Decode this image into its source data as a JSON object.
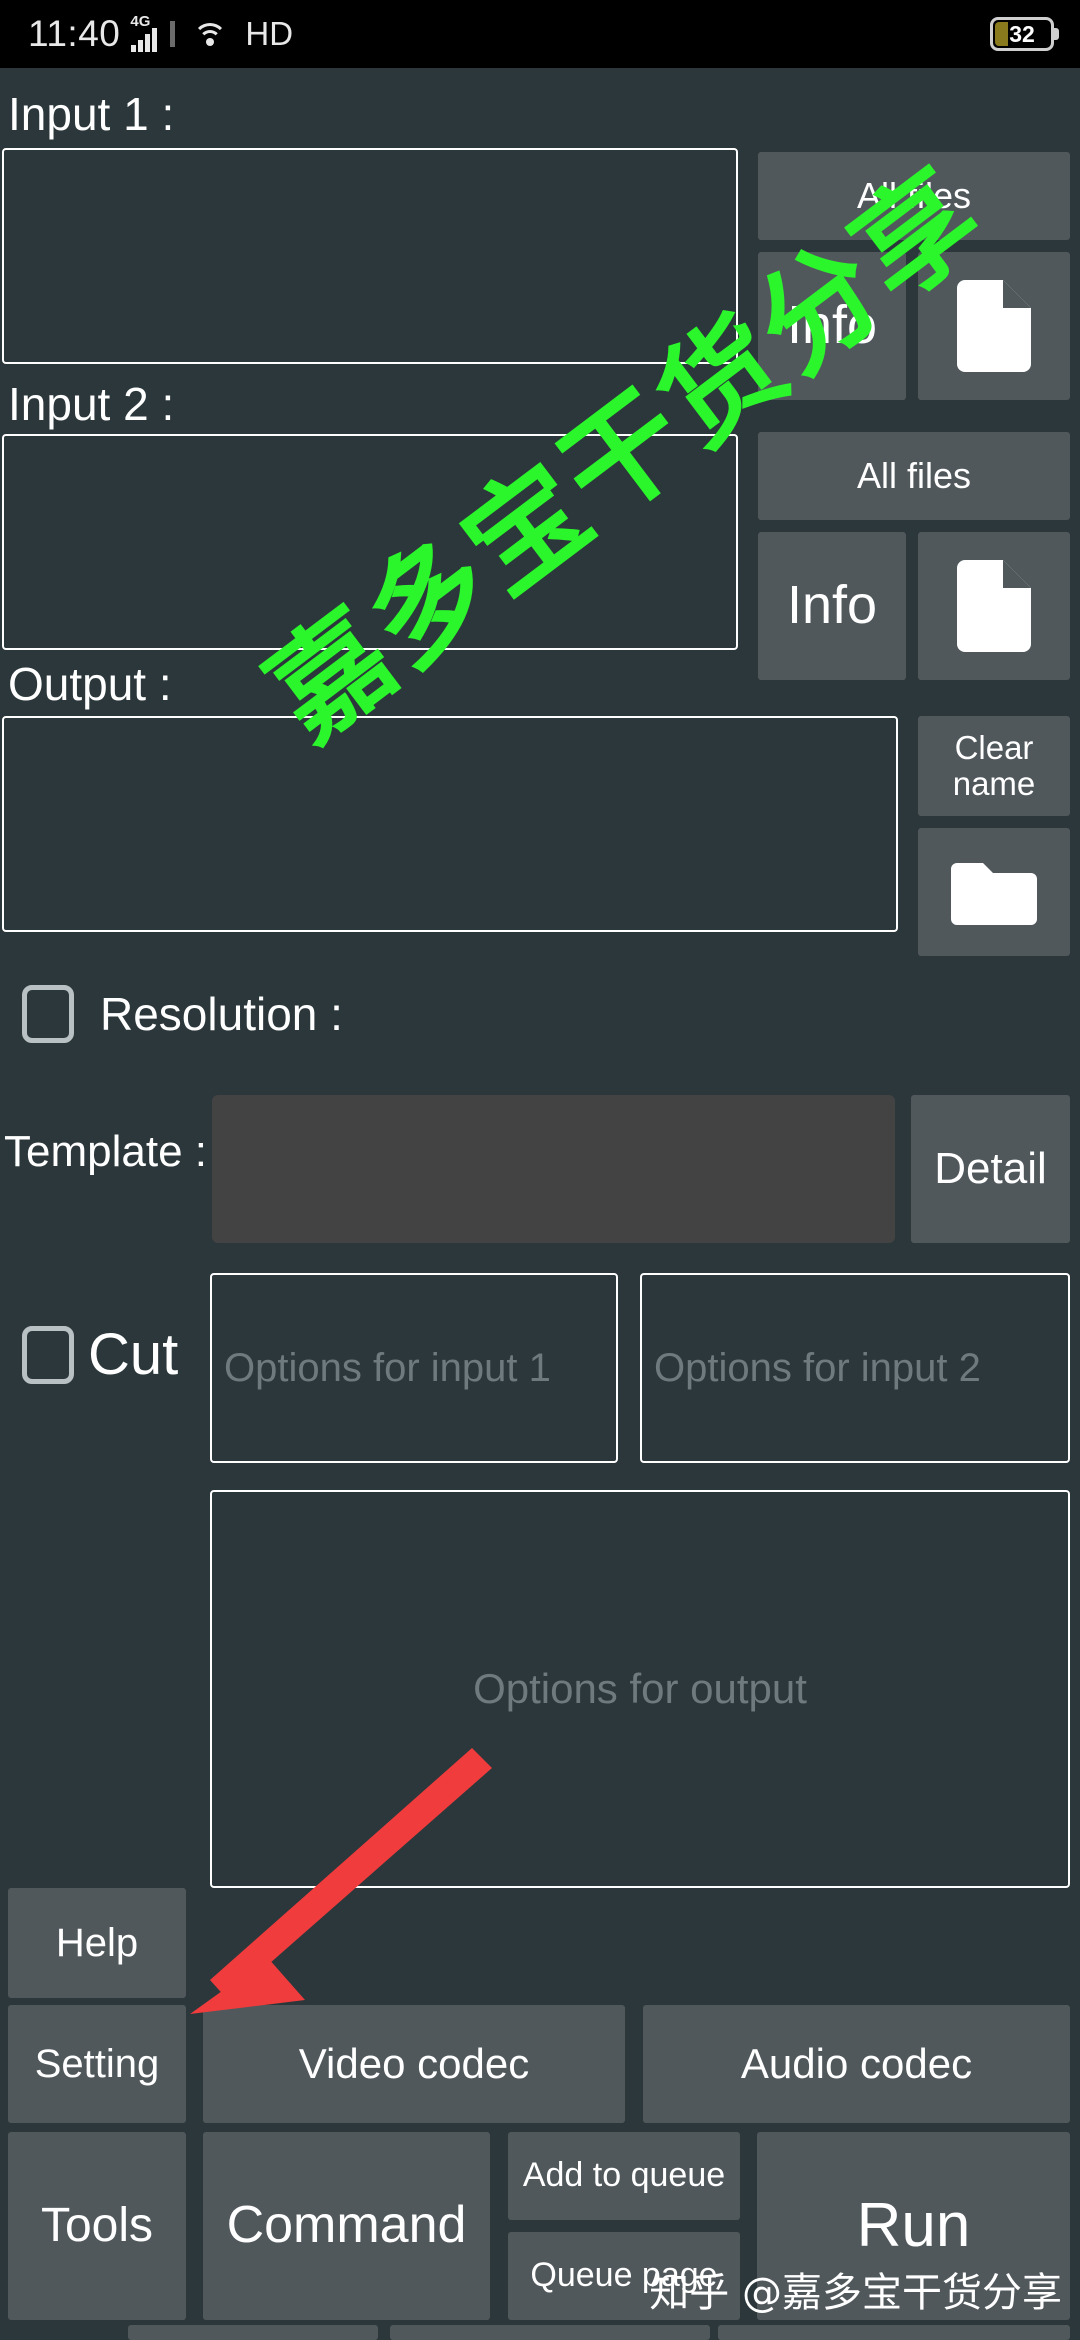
{
  "statusbar": {
    "time": "11:40",
    "network_type": "4G",
    "hd_label": "HD",
    "battery_level": "32",
    "icons": [
      "signal-icon",
      "wifi-icon",
      "battery-icon"
    ]
  },
  "inputs": [
    {
      "label": "Input 1 :",
      "value": "",
      "all_files_label": "All files",
      "info_label": "Info",
      "pick_icon": "document-icon"
    },
    {
      "label": "Input 2 :",
      "value": "",
      "all_files_label": "All files",
      "info_label": "Info",
      "pick_icon": "document-icon"
    }
  ],
  "output": {
    "label": "Output :",
    "value": "",
    "clear_name_label": "Clear name",
    "browse_icon": "folder-icon"
  },
  "resolution": {
    "label": "Resolution :",
    "checked": false
  },
  "template": {
    "label": "Template :",
    "selected": "",
    "detail_label": "Detail"
  },
  "cut": {
    "label": "Cut",
    "checked": false
  },
  "options": {
    "input1_placeholder": "Options for input 1",
    "input1_value": "",
    "input2_placeholder": "Options for input 2",
    "input2_value": "",
    "output_placeholder": "Options for output",
    "output_value": ""
  },
  "toolbar": {
    "help_label": "Help",
    "setting_label": "Setting",
    "video_codec_label": "Video codec",
    "audio_codec_label": "Audio codec",
    "tools_label": "Tools",
    "command_label": "Command",
    "add_to_queue_label": "Add to queue",
    "queue_page_label": "Queue page",
    "run_label": "Run"
  },
  "watermarks": {
    "green_text": "嘉多宝干货分享",
    "zhihu_text": "知乎 @嘉多宝干货分享"
  },
  "annotation": {
    "arrow_color": "#f03c3c",
    "points_to": "setting-button"
  },
  "colors": {
    "background": "#2b373b",
    "button": "#50585c",
    "template_select": "#434343",
    "field_border": "#ffffff",
    "placeholder": "#6f7a7e",
    "accent_green": "#2bf52b",
    "battery_fill": "#8a7a1e"
  }
}
